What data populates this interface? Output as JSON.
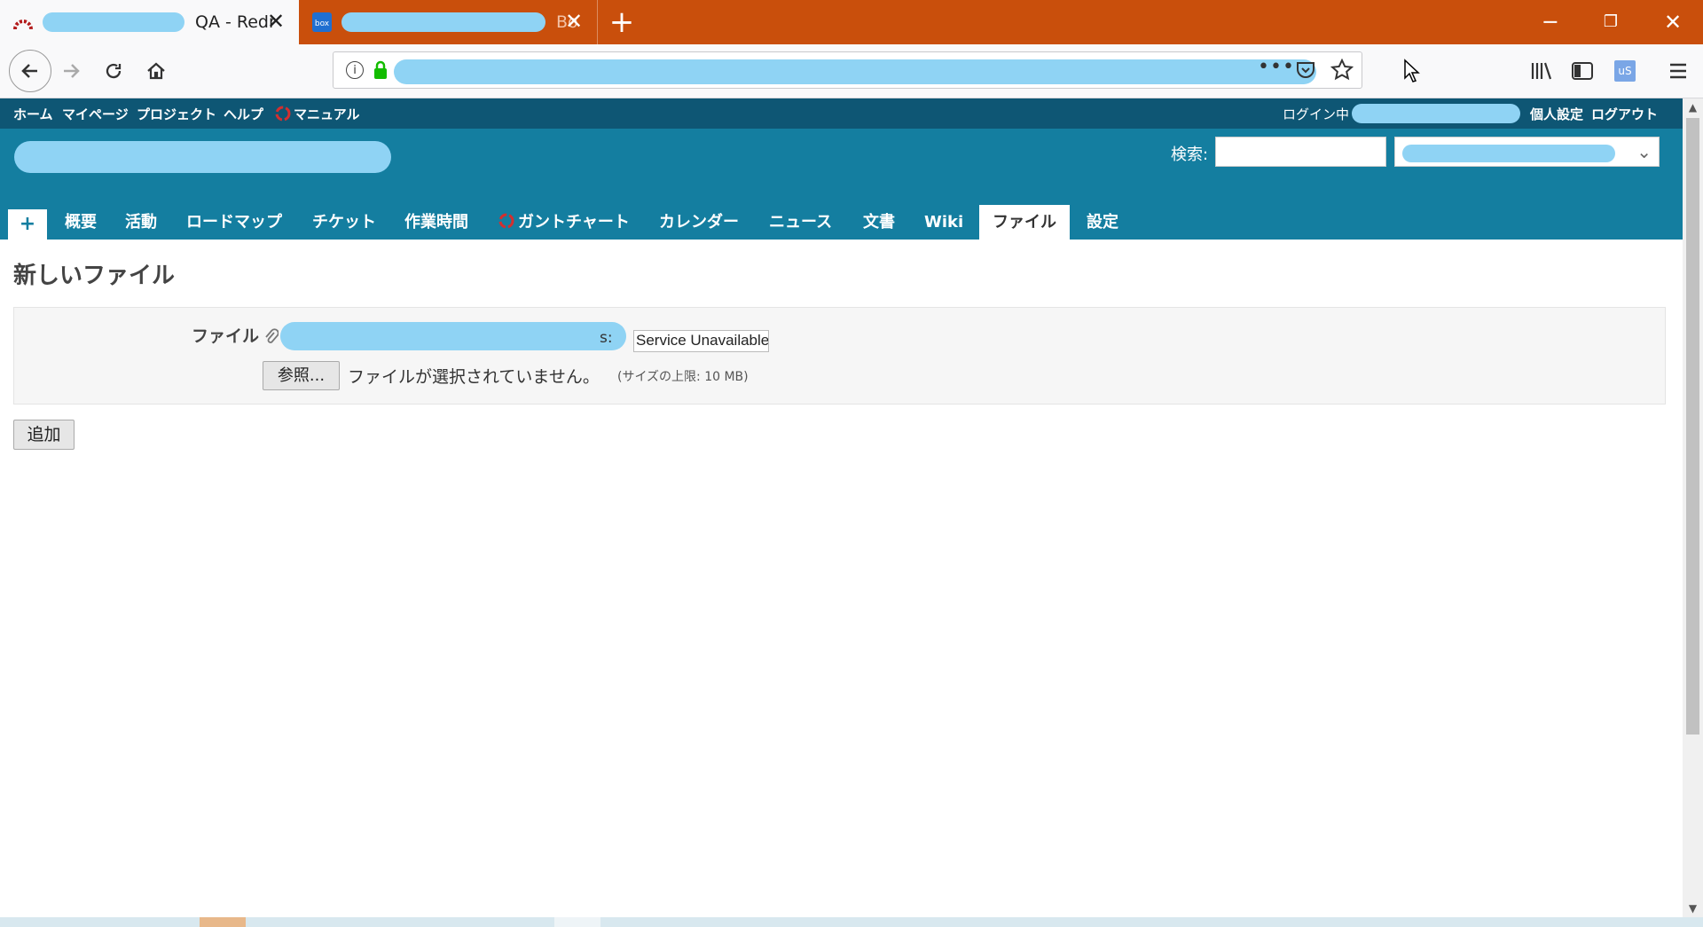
{
  "browser": {
    "active_tab_title": "QA - Redm",
    "inactive_tab_title": "Bo",
    "inactive_tab_favicon": "box",
    "new_tab_icon": "plus-icon",
    "window_controls": [
      "minimize",
      "restore",
      "close"
    ]
  },
  "redmine": {
    "topmenu": {
      "home": "ホーム",
      "mypage": "マイページ",
      "projects": "プロジェクト",
      "help": "ヘルプ",
      "manual": "マニュアル",
      "logged_in_as": "ログイン中",
      "my_account": "個人設定",
      "logout": "ログアウト"
    },
    "header": {
      "search_label": "検索:",
      "search_value": ""
    },
    "mainmenu": {
      "new": "+",
      "items": [
        "概要",
        "活動",
        "ロードマップ",
        "チケット",
        "作業時間",
        "ガントチャート",
        "カレンダー",
        "ニュース",
        "文書",
        "Wiki",
        "ファイル",
        "設定"
      ],
      "selected": "ファイル"
    },
    "content": {
      "page_title": "新しいファイル",
      "file_label": "ファイル",
      "filename_tail": "s:",
      "description_value": "Service Unavailable",
      "browse_button": "参照...",
      "no_file_selected": "ファイルが選択されていません。",
      "size_limit": "(サイズの上限: 10 MB)",
      "add_button": "追加"
    }
  },
  "colors": {
    "tabstrip": "#c94f0c",
    "topmenu": "#0e5674",
    "header": "#147ea0",
    "redaction": "#8fd3f4"
  }
}
